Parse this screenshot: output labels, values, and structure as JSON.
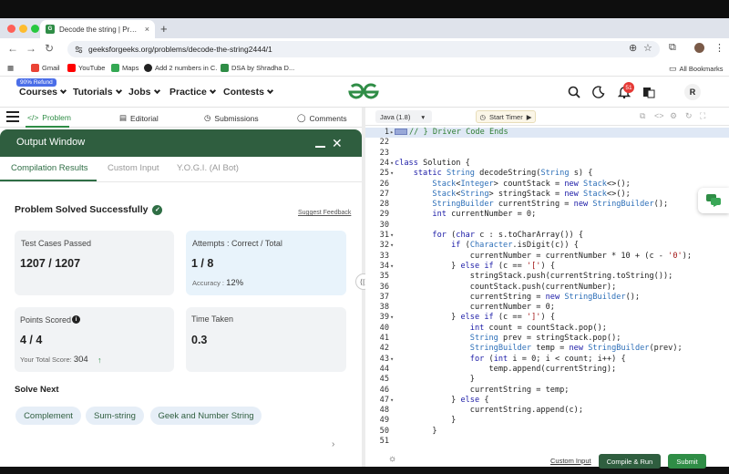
{
  "browser": {
    "tab_title": "Decode the string | Practice |",
    "tab_close": "×",
    "new_tab": "+",
    "url": "geeksforgeeks.org/problems/decode-the-string2444/1",
    "back": "←",
    "forward": "→",
    "reload": "↻",
    "bookmarks": [
      {
        "label": "Gmail",
        "color": "#ea4335"
      },
      {
        "label": "YouTube",
        "color": "#ff0000"
      },
      {
        "label": "Maps",
        "color": "#34a853"
      },
      {
        "label": "Add 2 numbers in C.",
        "color": "#222222"
      },
      {
        "label": "DSA by Shradha D...",
        "color": "#2f8d46"
      }
    ],
    "all_bookmarks": "All Bookmarks"
  },
  "gfg_nav": {
    "refund_badge": "90% Refund",
    "menus": [
      "Courses",
      "Tutorials",
      "Jobs",
      "Practice",
      "Contests"
    ],
    "notification_count": "51",
    "avatar_letter": "R",
    "brand_color": "#2f8d46"
  },
  "problem_tabs": [
    "Problem",
    "Editorial",
    "Submissions",
    "Comments"
  ],
  "output_window": {
    "title": "Output Window",
    "tabs": [
      "Compilation Results",
      "Custom Input",
      "Y.O.G.I. (AI Bot)"
    ],
    "status": "Problem Solved Successfully",
    "feedback_link": "Suggest Feedback",
    "cards": {
      "test_cases": {
        "label": "Test Cases Passed",
        "value": "1207 / 1207"
      },
      "attempts": {
        "label": "Attempts : Correct / Total",
        "value": "1 / 8",
        "sub_label": "Accuracy :",
        "sub_value": "12%"
      },
      "points": {
        "label": "Points Scored",
        "value": "4 / 4",
        "sub_label": "Your Total Score:",
        "sub_value": "304"
      },
      "time": {
        "label": "Time Taken",
        "value": "0.3"
      }
    },
    "solve_next_title": "Solve Next",
    "solve_next": [
      "Complement",
      "Sum-string",
      "Geek and Number String"
    ]
  },
  "editor": {
    "language": "Java (1.8)",
    "timer_label": "Start Timer",
    "custom_input": "Custom Input",
    "compile_run": "Compile & Run",
    "submit": "Submit",
    "lines": [
      {
        "n": "1",
        "fold": "▸",
        "code": "// } Driver Code Ends",
        "hl": true
      },
      {
        "n": "22",
        "fold": "",
        "code": ""
      },
      {
        "n": "23",
        "fold": "",
        "code": ""
      },
      {
        "n": "24",
        "fold": "▾",
        "code": "class Solution {"
      },
      {
        "n": "25",
        "fold": "▾",
        "code": "    static String decodeString(String s) {"
      },
      {
        "n": "26",
        "fold": "",
        "code": "        Stack<Integer> countStack = new Stack<>();"
      },
      {
        "n": "27",
        "fold": "",
        "code": "        Stack<String> stringStack = new Stack<>();"
      },
      {
        "n": "28",
        "fold": "",
        "code": "        StringBuilder currentString = new StringBuilder();"
      },
      {
        "n": "29",
        "fold": "",
        "code": "        int currentNumber = 0;"
      },
      {
        "n": "30",
        "fold": "",
        "code": ""
      },
      {
        "n": "31",
        "fold": "▾",
        "code": "        for (char c : s.toCharArray()) {"
      },
      {
        "n": "32",
        "fold": "▾",
        "code": "            if (Character.isDigit(c)) {"
      },
      {
        "n": "33",
        "fold": "",
        "code": "                currentNumber = currentNumber * 10 + (c - '0');"
      },
      {
        "n": "34",
        "fold": "▾",
        "code": "            } else if (c == '[') {"
      },
      {
        "n": "35",
        "fold": "",
        "code": "                stringStack.push(currentString.toString());"
      },
      {
        "n": "36",
        "fold": "",
        "code": "                countStack.push(currentNumber);"
      },
      {
        "n": "37",
        "fold": "",
        "code": "                currentString = new StringBuilder();"
      },
      {
        "n": "38",
        "fold": "",
        "code": "                currentNumber = 0;"
      },
      {
        "n": "39",
        "fold": "▾",
        "code": "            } else if (c == ']') {"
      },
      {
        "n": "40",
        "fold": "",
        "code": "                int count = countStack.pop();"
      },
      {
        "n": "41",
        "fold": "",
        "code": "                String prev = stringStack.pop();"
      },
      {
        "n": "42",
        "fold": "",
        "code": "                StringBuilder temp = new StringBuilder(prev);"
      },
      {
        "n": "43",
        "fold": "▾",
        "code": "                for (int i = 0; i < count; i++) {"
      },
      {
        "n": "44",
        "fold": "",
        "code": "                    temp.append(currentString);"
      },
      {
        "n": "45",
        "fold": "",
        "code": "                }"
      },
      {
        "n": "46",
        "fold": "",
        "code": "                currentString = temp;"
      },
      {
        "n": "47",
        "fold": "▾",
        "code": "            } else {"
      },
      {
        "n": "48",
        "fold": "",
        "code": "                currentString.append(c);"
      },
      {
        "n": "49",
        "fold": "",
        "code": "            }"
      },
      {
        "n": "50",
        "fold": "",
        "code": "        }"
      },
      {
        "n": "51",
        "fold": "",
        "code": ""
      }
    ]
  }
}
